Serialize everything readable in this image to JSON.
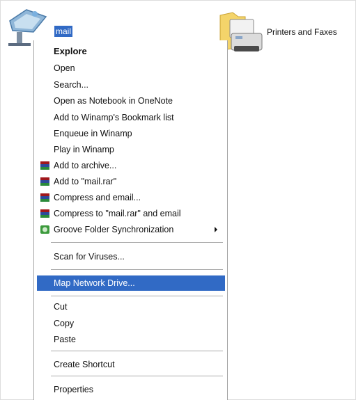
{
  "desktop": {
    "mail_label": "mail",
    "printers_label": "Printers and Faxes"
  },
  "menu": {
    "explore": "Explore",
    "open": "Open",
    "search": "Search...",
    "onenote": "Open as Notebook in OneNote",
    "winamp_bookmark": "Add to Winamp's Bookmark list",
    "enqueue": "Enqueue in Winamp",
    "play": "Play in Winamp",
    "add_archive": "Add to archive...",
    "add_rar": "Add to \"mail.rar\"",
    "compress_email": "Compress and email...",
    "compress_rar_email": "Compress to \"mail.rar\" and email",
    "groove": "Groove Folder Synchronization",
    "scan": "Scan for Viruses...",
    "map_drive": "Map Network Drive...",
    "cut": "Cut",
    "copy": "Copy",
    "paste": "Paste",
    "shortcut": "Create Shortcut",
    "properties": "Properties"
  },
  "colors": {
    "highlight": "#316ac5",
    "winrar_red": "#a0171b",
    "groove_green": "#3c9a3c"
  },
  "icons": {
    "mail": "network-folder-icon",
    "printers": "printer-folder-icon",
    "archive": "winrar-icon",
    "groove": "groove-icon",
    "submenu": "chevron-right-icon"
  }
}
